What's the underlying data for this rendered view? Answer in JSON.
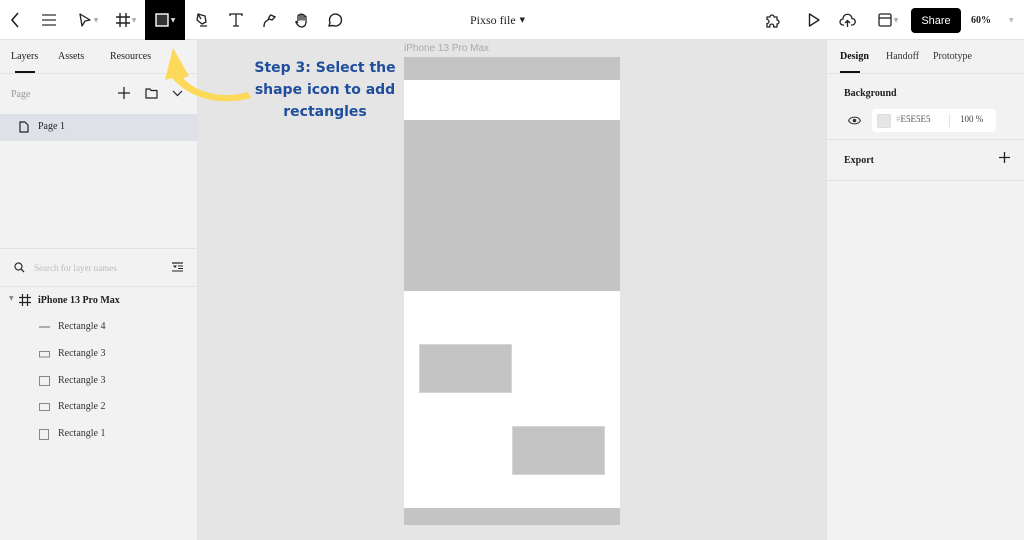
{
  "toolbar": {
    "file_title": "Pixso file",
    "share_label": "Share",
    "zoom_level": "60%",
    "tools": [
      {
        "name": "back",
        "icon": "chevron-left-icon"
      },
      {
        "name": "menu",
        "icon": "hamburger-menu-icon"
      },
      {
        "name": "move",
        "icon": "cursor-arrow-icon"
      },
      {
        "name": "frame",
        "icon": "frame-hash-icon"
      },
      {
        "name": "shape",
        "icon": "rectangle-icon",
        "active": true
      },
      {
        "name": "pen",
        "icon": "pen-icon"
      },
      {
        "name": "text",
        "icon": "text-icon"
      },
      {
        "name": "pencil",
        "icon": "pencil-path-icon"
      },
      {
        "name": "hand",
        "icon": "hand-icon"
      },
      {
        "name": "comment",
        "icon": "comment-icon"
      }
    ],
    "right_tools": [
      {
        "name": "plugins",
        "icon": "puzzle-icon"
      },
      {
        "name": "present",
        "icon": "play-icon"
      },
      {
        "name": "upload",
        "icon": "cloud-upload-icon"
      },
      {
        "name": "layout",
        "icon": "layout-panel-icon"
      }
    ]
  },
  "left_panel": {
    "tabs": [
      "Layers",
      "Assets",
      "Resources"
    ],
    "active_tab": "Layers",
    "page_section_label": "Page",
    "pages": [
      {
        "label": "Page 1",
        "selected": true
      }
    ],
    "search_placeholder": "Search for layer names",
    "layers": {
      "root": "iPhone 13 Pro Max",
      "children": [
        {
          "label": "Rectangle 4",
          "icon": "line-icon"
        },
        {
          "label": "Rectangle 3",
          "icon": "wide-rectangle-icon"
        },
        {
          "label": "Rectangle 3",
          "icon": "square-icon"
        },
        {
          "label": "Rectangle 2",
          "icon": "wide-rectangle-icon"
        },
        {
          "label": "Rectangle 1",
          "icon": "square-icon"
        }
      ]
    }
  },
  "canvas": {
    "frame_label": "iPhone 13 Pro Max",
    "annotation": {
      "lines": [
        "Step 3: Select the",
        "shape icon to add",
        "rectangles"
      ],
      "color": "#1f4e9c",
      "arrow_color": "#fdd95a"
    }
  },
  "right_panel": {
    "tabs": [
      "Design",
      "Handoff",
      "Prototype"
    ],
    "active_tab": "Design",
    "background": {
      "title": "Background",
      "hash": "#",
      "hex": "E5E5E5",
      "opacity": "100",
      "opacity_unit": "%"
    },
    "export": {
      "title": "Export"
    }
  },
  "colors": {
    "accent": "#000000",
    "canvas_bg": "#e5e5e5",
    "shape_fill": "#c4c4c4",
    "panel_bg": "#f2f2f2",
    "selected_row": "#dee1e8"
  }
}
